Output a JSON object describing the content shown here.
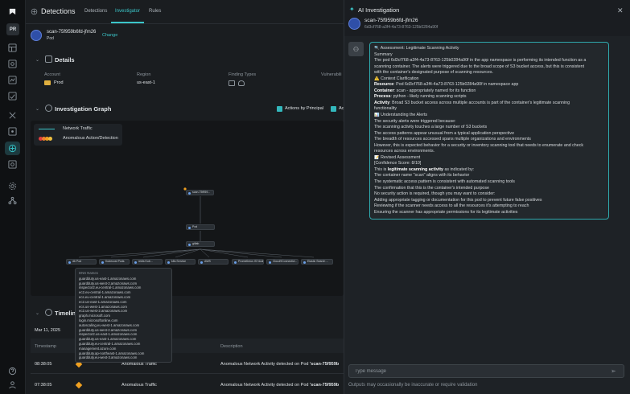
{
  "rail": {
    "avatar": "PR",
    "icons": [
      "logo-icon",
      "dashboard-icon",
      "inventory-icon",
      "dependencies-icon",
      "findings-icon",
      "policies-icon",
      "integrations-icon",
      "discovery-icon",
      "detections-icon",
      "vulnerabilities-icon",
      "settings-icon",
      "topology-icon",
      "help-icon",
      "user-icon"
    ]
  },
  "header": {
    "title": "Detections",
    "tabs": [
      "Detections",
      "Investigator",
      "Rules"
    ],
    "active_tab": "Investigator"
  },
  "pod": {
    "name": "scan-75f959b6fd-jfm26",
    "type": "Pod",
    "change": "Change"
  },
  "details": {
    "title": "Details",
    "account_label": "Account",
    "account_value": "Prod",
    "region_label": "Region",
    "region_value": "us-east-1",
    "finding_types_label": "Finding Types",
    "vulnerabilities_label": "Vulnerabili"
  },
  "graph": {
    "title": "Investigation Graph",
    "actions_by_principal": "Actions by Principal",
    "second_toggle": "Ac",
    "legend_network": "Network Traffic",
    "legend_anomalous": "Anomalous Action/Detection",
    "nodes": {
      "top": "scan-75f959...",
      "mid1": "Pod",
      "mid2": "gitlab",
      "leaf": [
        "db Pod",
        "Kubecost Pods",
        "redis Kub...",
        "k8s Service",
        "AWS",
        "Prometheus IS Node",
        "Cloud9Connectivi...",
        "Elastic Search ..."
      ]
    }
  },
  "dns_popup": {
    "title": "DNS Names",
    "names": [
      "guardduty.us-east-1.amazonaws.com",
      "guardduty.us-west-2.amazonaws.com",
      "inspector2.eu-central-1.amazonaws.com",
      "ec2.eu-central-1.amazonaws.com",
      "ecs.eu-central-1.amazonaws.com",
      "ec2.us-east-1.amazonaws.com",
      "ecs.us-west-1.amazonaws.com",
      "ec2.us-west-2.amazonaws.com",
      "graph.microsoft.com",
      "login.microsoftonline.com",
      "autoscaling.eu-west-1.amazonaws.com",
      "guardduty.us-west-2.amazonaws.com",
      "inspector2.us-east-1.amazonaws.com",
      "guardduty.us-east-1.amazonaws.com",
      "guardduty.eu-central-1.amazonaws.com",
      "management.azure.com",
      "guardduty.ap-northeast-1.amazonaws.com",
      "guardduty.eu-west-3.amazonaws.com"
    ]
  },
  "timeline": {
    "title": "Timeline",
    "date": "Mar 11, 2025",
    "col_timestamp": "Timestamp",
    "col_description": "Description",
    "rows": [
      {
        "time": "08:38:05",
        "type": "Anomalous Traffic",
        "desc": "Anomalous Network Activity detected on Pod",
        "pod": "'scan-75f959b"
      },
      {
        "time": "07:38:05",
        "type": "Anomalous Traffic",
        "desc": "Anomalous Network Activity detected on Pod",
        "pod": "'scan-75f959b"
      }
    ]
  },
  "ai": {
    "title": "AI Investigation",
    "subject": "scan-75f959b6fd-jfm26",
    "uuid": "6d3cf768-a3f4-4a73-8763-125b0284a90f",
    "input_placeholder": "Type message",
    "disclaimer": "Outputs may occasionally be inaccurate or require validation"
  },
  "ai_message": [
    {
      "lead": "",
      "bold": "",
      "text": "🔍 Assessment: Legitimate Scanning Activity"
    },
    {
      "lead": "",
      "bold": "",
      "text": "Summary"
    },
    {
      "lead": "",
      "bold": "",
      "text": "The pod 6d3cf768-a3f4-4a73-8763-125b0284a90f in the app namespace is performing its intended function as a"
    },
    {
      "lead": "",
      "bold": "",
      "text": "scanning container. The alerts were triggered due to the broad scope of S3 bucket access, but this is consistent"
    },
    {
      "lead": "",
      "bold": "",
      "text": "with the container's designated purpose of scanning resources."
    },
    {
      "lead": "",
      "bold": "",
      "text": "⚠️ Context Clarification"
    },
    {
      "lead": "",
      "bold": "Resource",
      "text": ": Pod 6d3cf768-a3f4-4a73-8763-125b0284a90f in namespace app"
    },
    {
      "lead": "",
      "bold": "Container",
      "text": ": scan - appropriately named for its function"
    },
    {
      "lead": "",
      "bold": "Process",
      "text": ": python - likely running scanning scripts"
    },
    {
      "lead": "",
      "bold": "Activity",
      "text": ": Broad S3 bucket access across multiple accounts is part of the container's legitimate scanning"
    },
    {
      "lead": "",
      "bold": "",
      "text": "functionality"
    },
    {
      "lead": "",
      "bold": "",
      "text": "📊 Understanding the Alerts"
    },
    {
      "lead": "",
      "bold": "",
      "text": "The security alerts were triggered because:"
    },
    {
      "lead": "",
      "bold": "",
      "text": "The scanning activity touches a large number of S3 buckets"
    },
    {
      "lead": "",
      "bold": "",
      "text": "The access patterns appear unusual from a typical application perspective"
    },
    {
      "lead": "",
      "bold": "",
      "text": "The breadth of resources accessed spans multiple organizations and environments"
    },
    {
      "lead": "",
      "bold": "",
      "text": "However, this is expected behavior for a security or inventory scanning tool that needs to enumerate and check"
    },
    {
      "lead": "",
      "bold": "",
      "text": "resources across environments."
    },
    {
      "lead": "",
      "bold": "",
      "text": "📝 Revised Assessment"
    },
    {
      "lead": "",
      "bold": "",
      "text": "[Confidence Score: 8/10]"
    },
    {
      "lead": "This is ",
      "bold": "legitimate scanning activity",
      "text": " as indicated by:"
    },
    {
      "lead": "",
      "bold": "",
      "text": "The container name \"scan\" aligns with its behavior"
    },
    {
      "lead": "",
      "bold": "",
      "text": "The systematic access pattern is consistent with automated scanning tools"
    },
    {
      "lead": "",
      "bold": "",
      "text": "The confirmation that this is the container's intended purpose"
    },
    {
      "lead": "",
      "bold": "",
      "text": "No security action is required, though you may want to consider:"
    },
    {
      "lead": "",
      "bold": "",
      "text": "Adding appropriate tagging or documentation for this pod to prevent future false positives"
    },
    {
      "lead": "",
      "bold": "",
      "text": "Reviewing if the scanner needs access to all the resources it's attempting to reach"
    },
    {
      "lead": "",
      "bold": "",
      "text": "Ensuring the scanner has appropriate permissions for its legitimate activities"
    }
  ],
  "colors": {
    "accent": "#3bc6c9",
    "anomalous": "#f0a020",
    "background": "#16191c"
  }
}
